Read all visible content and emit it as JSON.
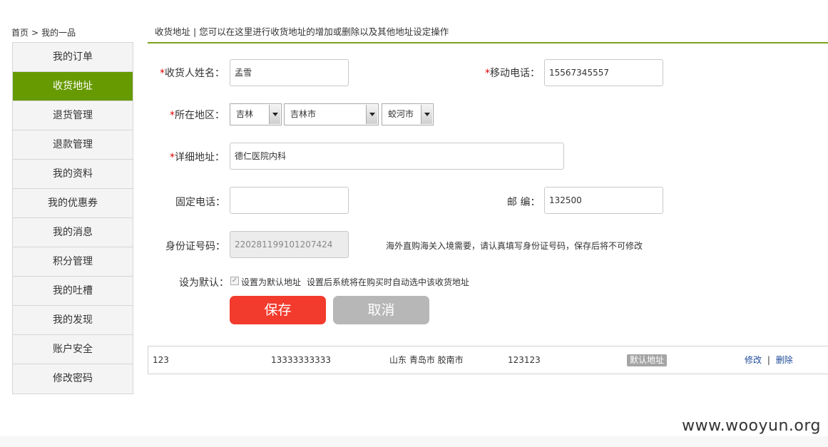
{
  "breadcrumb": {
    "home": "首页",
    "separator": ">",
    "current": "我的一品"
  },
  "sidebar": {
    "items": [
      {
        "label": "我的订单"
      },
      {
        "label": "收货地址"
      },
      {
        "label": "退货管理"
      },
      {
        "label": "退款管理"
      },
      {
        "label": "我的资料"
      },
      {
        "label": "我的优惠券"
      },
      {
        "label": "我的消息"
      },
      {
        "label": "积分管理"
      },
      {
        "label": "我的吐槽"
      },
      {
        "label": "我的发现"
      },
      {
        "label": "账户安全"
      },
      {
        "label": "修改密码"
      }
    ],
    "active_color": "#669a00"
  },
  "header": {
    "title": "收货地址",
    "separator": "|",
    "description": "您可以在这里进行收货地址的增加或删除以及其他地址设定操作"
  },
  "form": {
    "required_mark": "*",
    "name_label": "收货人姓名：",
    "name_value": "孟雪",
    "mobile_label": "移动电话：",
    "mobile_value": "15567345557",
    "region_label": "所在地区：",
    "province": "吉林",
    "city": "吉林市",
    "district": "蛟河市",
    "address_label": "详细地址：",
    "address_value": "德仁医院内科",
    "phone_label": "固定电话：",
    "phone_value": "",
    "zip_label": "邮 编：",
    "zip_value": "132500",
    "id_label": "身份证号码：",
    "id_value": "220281199101207424",
    "id_hint": "海外直购海关入境需要，请认真填写身份证号码，保存后将不可修改",
    "default_label": "设为默认：",
    "default_checkbox_label": "设置为默认地址",
    "default_hint": "设置后系统将在购买时自动选中该收货地址",
    "save_label": "保存",
    "cancel_label": "取消"
  },
  "address_list": [
    {
      "name": "123",
      "phone": "13333333333",
      "region": "山东  青岛市  胶南市",
      "zip": "123123",
      "badge": "默认地址",
      "edit_label": "修改",
      "action_separator": "|",
      "delete_label": "删除"
    }
  ],
  "watermark": "www.wooyun.org",
  "colors": {
    "accent": "#669a00",
    "save": "#f23b2d",
    "cancel": "#b7b7b7",
    "required": "#dd0000",
    "link": "#1f4b99"
  }
}
